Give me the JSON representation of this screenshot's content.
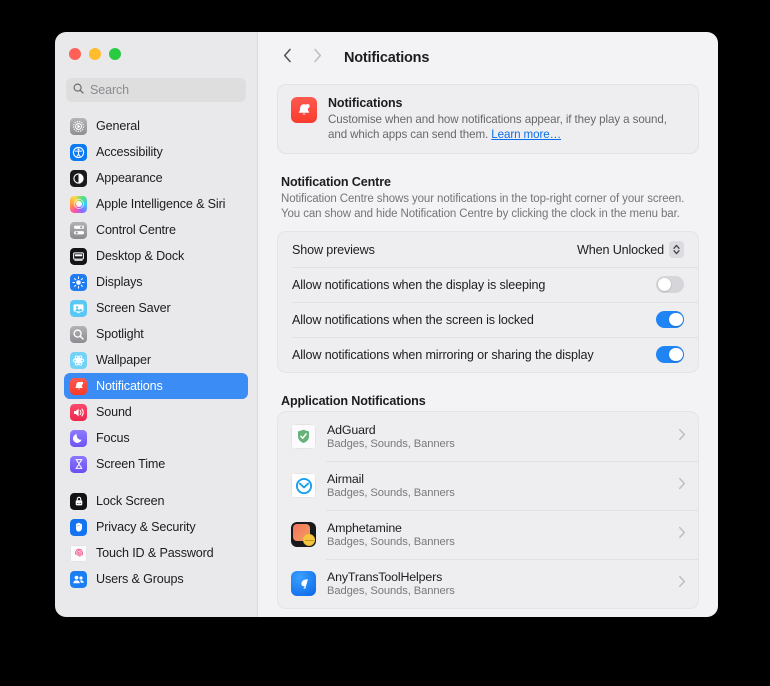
{
  "window": {
    "traffic_lights": [
      {
        "name": "close",
        "color": "#ff6159"
      },
      {
        "name": "minimise",
        "color": "#ffbd2e"
      },
      {
        "name": "maximise",
        "color": "#2acb42"
      }
    ]
  },
  "sidebar": {
    "search": {
      "placeholder": "Search",
      "icon": "search-icon"
    },
    "items": [
      {
        "label": "General",
        "icon": "general-icon",
        "key": "general",
        "selected": false
      },
      {
        "label": "Accessibility",
        "icon": "accessibility-icon",
        "key": "accessibility",
        "selected": false
      },
      {
        "label": "Appearance",
        "icon": "appearance-icon",
        "key": "appearance",
        "selected": false
      },
      {
        "label": "Apple Intelligence & Siri",
        "icon": "siri-icon",
        "key": "apple-intelligence-siri",
        "selected": false
      },
      {
        "label": "Control Centre",
        "icon": "control-centre-icon",
        "key": "control-centre",
        "selected": false
      },
      {
        "label": "Desktop & Dock",
        "icon": "desktop-dock-icon",
        "key": "desktop-dock",
        "selected": false
      },
      {
        "label": "Displays",
        "icon": "displays-icon",
        "key": "displays",
        "selected": false
      },
      {
        "label": "Screen Saver",
        "icon": "screen-saver-icon",
        "key": "screen-saver",
        "selected": false
      },
      {
        "label": "Spotlight",
        "icon": "spotlight-icon",
        "key": "spotlight",
        "selected": false
      },
      {
        "label": "Wallpaper",
        "icon": "wallpaper-icon",
        "key": "wallpaper",
        "selected": false
      },
      {
        "label": "Notifications",
        "icon": "notifications-icon",
        "key": "notifications",
        "selected": true
      },
      {
        "label": "Sound",
        "icon": "sound-icon",
        "key": "sound",
        "selected": false
      },
      {
        "label": "Focus",
        "icon": "focus-icon",
        "key": "focus",
        "selected": false
      },
      {
        "label": "Screen Time",
        "icon": "screen-time-icon",
        "key": "screen-time",
        "selected": false
      },
      {
        "label": "Lock Screen",
        "icon": "lock-screen-icon",
        "key": "lock-screen",
        "selected": false
      },
      {
        "label": "Privacy & Security",
        "icon": "privacy-security-icon",
        "key": "privacy-security",
        "selected": false
      },
      {
        "label": "Touch ID & Password",
        "icon": "touch-id-icon",
        "key": "touch-id-password",
        "selected": false
      },
      {
        "label": "Users & Groups",
        "icon": "users-groups-icon",
        "key": "users-groups",
        "selected": false
      }
    ],
    "separator_after_index": 13
  },
  "toolbar": {
    "back_icon": "chevron-left-icon",
    "forward_icon": "chevron-right-icon",
    "title": "Notifications"
  },
  "banner": {
    "icon": "notifications-bell-icon",
    "title": "Notifications",
    "description": "Customise when and how notifications appear, if they play a sound, and which apps can send them. ",
    "link": "Learn more…"
  },
  "notification_centre": {
    "title": "Notification Centre",
    "description": "Notification Centre shows your notifications in the top-right corner of your screen. You can show and hide Notification Centre by clicking the clock in the menu bar.",
    "rows": [
      {
        "label": "Show previews",
        "control": "popup",
        "value": "When Unlocked",
        "name": "show-previews-popup"
      },
      {
        "label": "Allow notifications when the display is sleeping",
        "control": "toggle",
        "on": false,
        "name": "allow-when-display-sleeping-toggle"
      },
      {
        "label": "Allow notifications when the screen is locked",
        "control": "toggle",
        "on": true,
        "name": "allow-when-screen-locked-toggle"
      },
      {
        "label": "Allow notifications when mirroring or sharing the display",
        "control": "toggle",
        "on": true,
        "name": "allow-when-mirroring-toggle"
      }
    ]
  },
  "application_notifications": {
    "title": "Application Notifications",
    "apps": [
      {
        "name": "AdGuard",
        "detail": "Badges, Sounds, Banners",
        "icon": "adguard-icon"
      },
      {
        "name": "Airmail",
        "detail": "Badges, Sounds, Banners",
        "icon": "airmail-icon"
      },
      {
        "name": "Amphetamine",
        "detail": "Badges, Sounds, Banners",
        "icon": "amphetamine-icon"
      },
      {
        "name": "AnyTransToolHelpers",
        "detail": "Badges, Sounds, Banners",
        "icon": "anytrans-icon"
      }
    ],
    "disclosure_icon": "chevron-right-icon"
  },
  "colors": {
    "accent": "#3b8cf4",
    "toggle_on": "#1f85f5",
    "link": "#0a6fe8",
    "sidebar_bg": "#e9e9eb",
    "content_bg": "#f3f3f5"
  }
}
